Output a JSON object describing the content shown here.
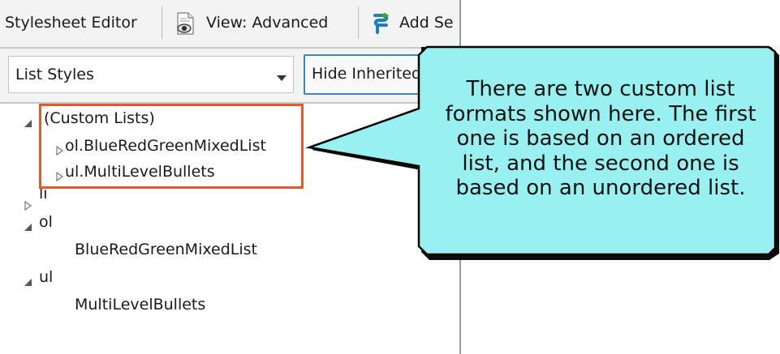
{
  "toolbar": {
    "title": "Stylesheet Editor",
    "view_label": "View: Advanced",
    "view_icon": "eye-icon",
    "add_label": "Add Se",
    "add_icon": "add-style-icon"
  },
  "filter": {
    "dropdown_value": "List Styles",
    "hide_button_label": "Hide Inherited"
  },
  "tree": {
    "custom_lists": {
      "label": "(Custom Lists)",
      "children": [
        "ol.BlueRedGreenMixedList",
        "ul.MultiLevelBullets"
      ]
    },
    "li": {
      "label": "li"
    },
    "ol": {
      "label": "ol",
      "children": [
        "BlueRedGreenMixedList"
      ]
    },
    "ul": {
      "label": "ul",
      "children": [
        "MultiLevelBullets"
      ]
    }
  },
  "callout": {
    "lines": [
      "There are two custom list",
      "formats shown here. The first",
      "one is based on an ordered",
      "list, and the second one is",
      "based on an unordered list."
    ]
  },
  "colors": {
    "callout_fill": "#99f0f0",
    "highlight_border": "#e05a2c",
    "button_border": "#3c83c9"
  }
}
